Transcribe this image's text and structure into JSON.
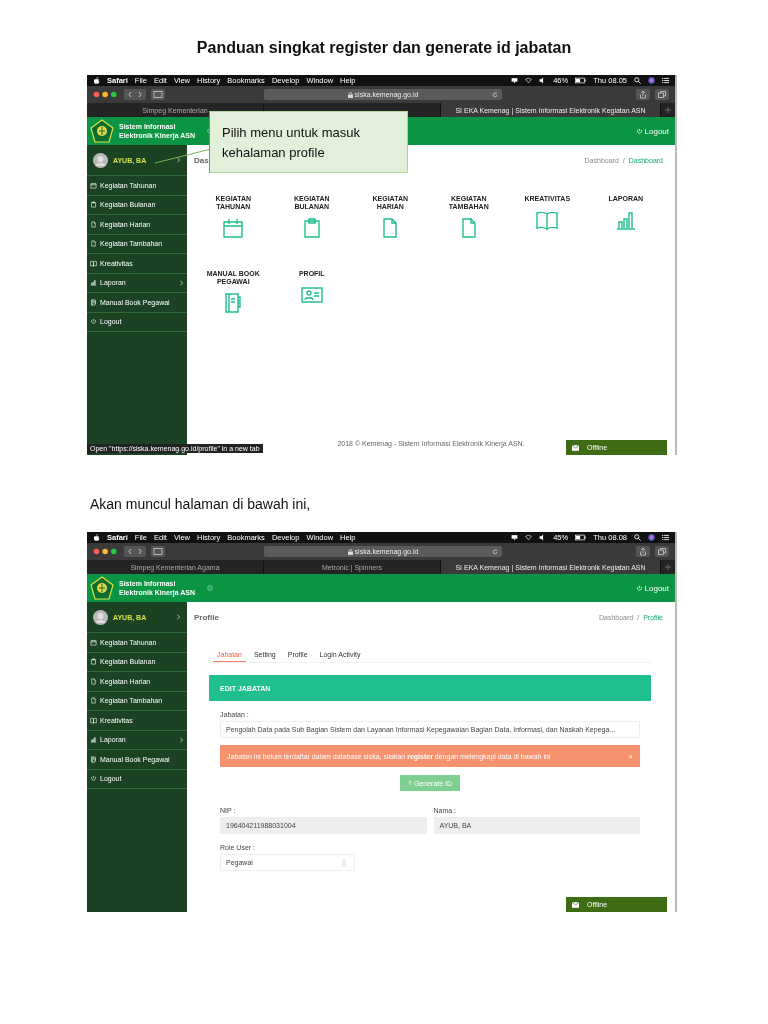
{
  "doc_title": "Panduan singkat register dan generate id jabatan",
  "screenshots": [
    {
      "kind": "dashboard",
      "menubar": {
        "app": "Safari",
        "menus": [
          "File",
          "Edit",
          "View",
          "History",
          "Bookmarks",
          "Develop",
          "Window",
          "Help"
        ],
        "battery": "46%",
        "clock": "Thu 08.05"
      },
      "url": "siska.kemenag.go.id",
      "tabs": [
        {
          "label": "Simpeg Kementerian",
          "selected": false
        },
        {
          "selected": false
        },
        {
          "label": "SI EKA Kemenag | Sistem Informasi Elektronik Kegiatan ASN",
          "selected": true
        }
      ],
      "brand": "Sistem Informasi Elektronik Kinerja ASN",
      "logout": "Logout",
      "user": {
        "name": "AYUB, BA",
        "expandable": true
      },
      "sidebar": [
        {
          "label": "Kegiatan Tahunan",
          "has_submenu": false
        },
        {
          "label": "Kegiatan Bulanan",
          "has_submenu": false
        },
        {
          "label": "Kegiatan Harian",
          "has_submenu": false
        },
        {
          "label": "Kegiatan Tambahan",
          "has_submenu": false
        },
        {
          "label": "Kreativitas",
          "has_submenu": false
        },
        {
          "label": "Laporan",
          "has_submenu": true
        },
        {
          "label": "Manual Book Pegawai",
          "has_submenu": false
        },
        {
          "label": "Logout",
          "has_submenu": false
        }
      ],
      "page_title": "Das",
      "breadcrumb": [
        "Dashboard",
        "Dashboard"
      ],
      "breadcrumb_separator": "/",
      "tiles": [
        "KEGIATAN TAHUNAN",
        "KEGIATAN BULANAN",
        "KEGIATAN HARIAN",
        "KEGIATAN TAMBAHAN",
        "KREATIVITAS",
        "LAPORAN",
        "MANUAL BOOK PEGAWAI",
        "PROFIL"
      ],
      "footer": "2018 © Kemenag - Sistem Informasi Elektronik Kinerja ASN.",
      "status_link": "Open \"https://siska.kemenag.go.id/profile\" in a new tab",
      "chat": "Offline",
      "callout": "Pilih menu untuk masuk kehalaman profile"
    },
    {
      "kind": "profile",
      "intro": "Akan muncul halaman di bawah ini,",
      "menubar": {
        "app": "Safari",
        "menus": [
          "File",
          "Edit",
          "View",
          "History",
          "Bookmarks",
          "Develop",
          "Window",
          "Help"
        ],
        "battery": "45%",
        "clock": "Thu 08.08"
      },
      "url": "siska.kemenag.go.id",
      "tabs": [
        {
          "label": "Simpeg Kementerian Agama",
          "selected": false
        },
        {
          "label": "Metronic | Spinners",
          "selected": false
        },
        {
          "label": "SI EKA Kemenag | Sistem Informasi Elektronik Kegiatan ASN",
          "selected": true
        }
      ],
      "brand": "Sistem Informasi Elektronik Kinerja ASN",
      "logout": "Logout",
      "user": {
        "name": "AYUB, BA",
        "expandable": true
      },
      "sidebar": [
        {
          "label": "Kegiatan Tahunan",
          "has_submenu": false
        },
        {
          "label": "Kegiatan Bulanan",
          "has_submenu": false
        },
        {
          "label": "Kegiatan Harian",
          "has_submenu": false
        },
        {
          "label": "Kegiatan Tambahan",
          "has_submenu": false
        },
        {
          "label": "Kreativitas",
          "has_submenu": false
        },
        {
          "label": "Laporan",
          "has_submenu": true
        },
        {
          "label": "Manual Book Pegawai",
          "has_submenu": false
        },
        {
          "label": "Logout",
          "has_submenu": false
        }
      ],
      "page_title": "Profile",
      "breadcrumb": [
        "Dashboard",
        "Profile"
      ],
      "breadcrumb_separator": "/",
      "profile_tabs": [
        {
          "label": "Jabatan",
          "selected": true
        },
        {
          "label": "Setting",
          "selected": false
        },
        {
          "label": "Profile",
          "selected": false
        },
        {
          "label": "Login Activity",
          "selected": false
        }
      ],
      "panel_title": "EDIT JABATAN",
      "jabatan_label": "Jabatan :",
      "jabatan_value": "Pengolah Data pada Sub Bagian Sistem dan Layanan Informasi Kepegawaian Bagian Data, Informasi, dan Naskah Kepega...",
      "alert": "Jabatan ini belum terdaftar dalam database siska, silakan **register** dengan melengkapi data di bawah ini",
      "alert_close": "×",
      "generate_button": "Generate ID",
      "nip_label": "NIP :",
      "nip_value": "196404211988031004",
      "nama_label": "Nama :",
      "nama_value": "AYUB, BA",
      "role_label": "Role User :",
      "role_value": "Pegawai",
      "chat": "Offline"
    }
  ]
}
